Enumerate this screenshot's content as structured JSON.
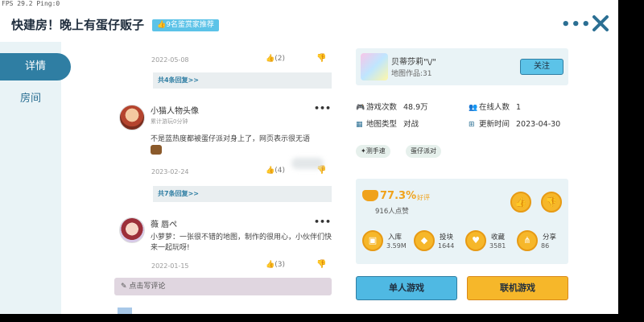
{
  "status": {
    "fps": "FPS 29.2  Ping:0"
  },
  "header": {
    "title": "快建房！晚上有蛋仔贩子",
    "badge": "👍9名鉴赏家推荐"
  },
  "sidebar": {
    "items": [
      {
        "label": "详情"
      },
      {
        "label": "房间"
      }
    ]
  },
  "comments": {
    "top_date": "2022-05-08",
    "top_likes": "(2)",
    "top_replies": "共4条回复>>",
    "items": [
      {
        "name": "小猫人物头像",
        "sub": "累计游玩0分钟",
        "text": "不是蓝热度都被蛋仔派对身上了，网页表示很无语",
        "date": "2023-02-24",
        "likes": "(4)",
        "replies": "共7条回复>>"
      },
      {
        "name": "薇 唇ぺ",
        "text": "小萝萝：一张很不错的地图，制作的很用心，小伙伴们快来一起玩呀!",
        "date": "2022-01-15",
        "likes": "(3)"
      }
    ],
    "write_placeholder": "点击写评论"
  },
  "author": {
    "name": "贝蒂莎莉\"\\/\"",
    "works": "地图作品:31",
    "follow": "关注"
  },
  "stats": {
    "plays_label": "游戏次数",
    "plays_value": "48.9万",
    "online_label": "在线人数",
    "online_value": "1",
    "type_label": "地图类型",
    "type_value": "对战",
    "updated_label": "更新时间",
    "updated_value": "2023-04-30"
  },
  "tags": [
    "测手速",
    "蛋仔派对"
  ],
  "rating": {
    "percent": "77.3%",
    "label": "好评",
    "count": "916人点赞",
    "actions": [
      {
        "label": "入库",
        "value": "3.59M"
      },
      {
        "label": "投块",
        "value": "1644"
      },
      {
        "label": "收藏",
        "value": "3581"
      },
      {
        "label": "分享",
        "value": "86"
      }
    ]
  },
  "buttons": {
    "single": "单人游戏",
    "multi": "联机游戏"
  },
  "colors": {
    "accent": "#2f7ea3",
    "sky": "#5cc3e8",
    "orange": "#f6b72a"
  },
  "icons": [
    "close-icon",
    "more-icon",
    "thumb-up-icon",
    "thumb-down-icon",
    "edit-icon"
  ]
}
